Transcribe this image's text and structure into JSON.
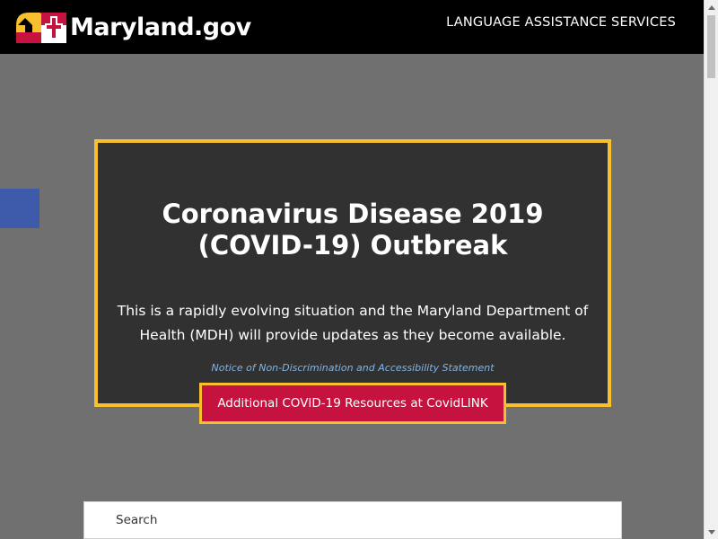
{
  "header": {
    "logo_text": "Maryland.gov",
    "language_link": "LANGUAGE ASSISTANCE SERVICES"
  },
  "alert": {
    "title_line1": "Coronavirus Disease 2019",
    "title_line2": "(COVID-19) Outbreak",
    "body": "This is a rapidly evolving situation and the Maryland Department of Health (MDH) will provide updates as they become available.",
    "notice_link": "Notice of Non-Discrimination and Accessibility Statement",
    "button_label": "Additional COVID-19 Resources at CovidLINK"
  },
  "search": {
    "placeholder": "Search"
  },
  "colors": {
    "header_bg": "#000000",
    "page_bg": "#707070",
    "alert_bg": "#313131",
    "alert_border": "#f7c02c",
    "button_bg": "#c6123f",
    "link_blue": "#7fb6e8",
    "side_tab": "#3e5bab"
  },
  "icons": {
    "logo": "maryland-flag-icon",
    "scroll_up": "scroll-up-arrow-icon",
    "scroll_down": "scroll-down-arrow-icon"
  }
}
